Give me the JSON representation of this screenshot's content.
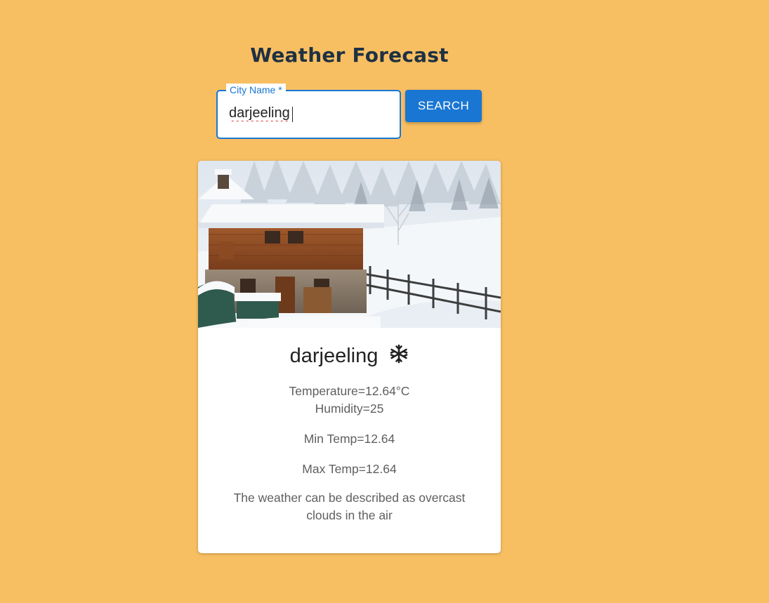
{
  "header": {
    "title": "Weather Forecast"
  },
  "search": {
    "label": "City Name *",
    "value": "darjeeling",
    "button_label": "SEARCH"
  },
  "card": {
    "image_icon": "snowy-chalet-photo",
    "city": "darjeeling",
    "weather_icon": "snowflake-icon",
    "temperature": "Temperature=12.64°C",
    "humidity": "Humidity=25",
    "min_temp": "Min Temp=12.64",
    "max_temp": "Max Temp=12.64",
    "description": "The weather can be described as overcast clouds in the air"
  },
  "colors": {
    "background": "#f8bf62",
    "accent": "#1976d2",
    "title": "#1f3142"
  }
}
